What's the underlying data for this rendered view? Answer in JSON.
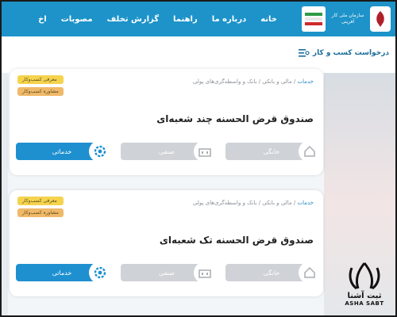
{
  "nav": {
    "logo_text": "سازمان ملی کار آفرینی",
    "items": [
      "خانه",
      "درباره ما",
      "راهنما",
      "گزارش تخلف",
      "مصوبات",
      "اخ"
    ]
  },
  "header": {
    "request_label": "درخواست کسب و کار"
  },
  "cards": [
    {
      "crumb_1": "خدمات",
      "crumb_2": "مالی و بانکی",
      "crumb_3": "بانک و واسطه‌گری‌های پولی",
      "badge_1": "معرفی کسب‌وکار",
      "badge_2": "مشاوره کسب‌وکار",
      "title": "صندوق قرض الحسنه چند شعبه‌ای",
      "choice_active": "خدماتی",
      "choice_2": "صنفی",
      "choice_3": "خانگی"
    },
    {
      "crumb_1": "خدمات",
      "crumb_2": "مالی و بانکی",
      "crumb_3": "بانک و واسطه‌گری‌های پولی",
      "badge_1": "معرفی کسب‌وکار",
      "badge_2": "مشاوره کسب‌وکار",
      "title": "صندوق قرض الحسنه تک شعبه‌ای",
      "choice_active": "خدماتی",
      "choice_2": "صنفی",
      "choice_3": "خانگی"
    }
  ],
  "watermark": {
    "fa": "ثبت آشنا",
    "en": "ASHA SABT"
  },
  "colors": {
    "nav_bg": "#1d93c9",
    "active_chip": "#1e90d0",
    "inactive_chip": "#cfd2d6",
    "badge_yellow": "#f5d34d",
    "badge_orange": "#f0b96a"
  }
}
